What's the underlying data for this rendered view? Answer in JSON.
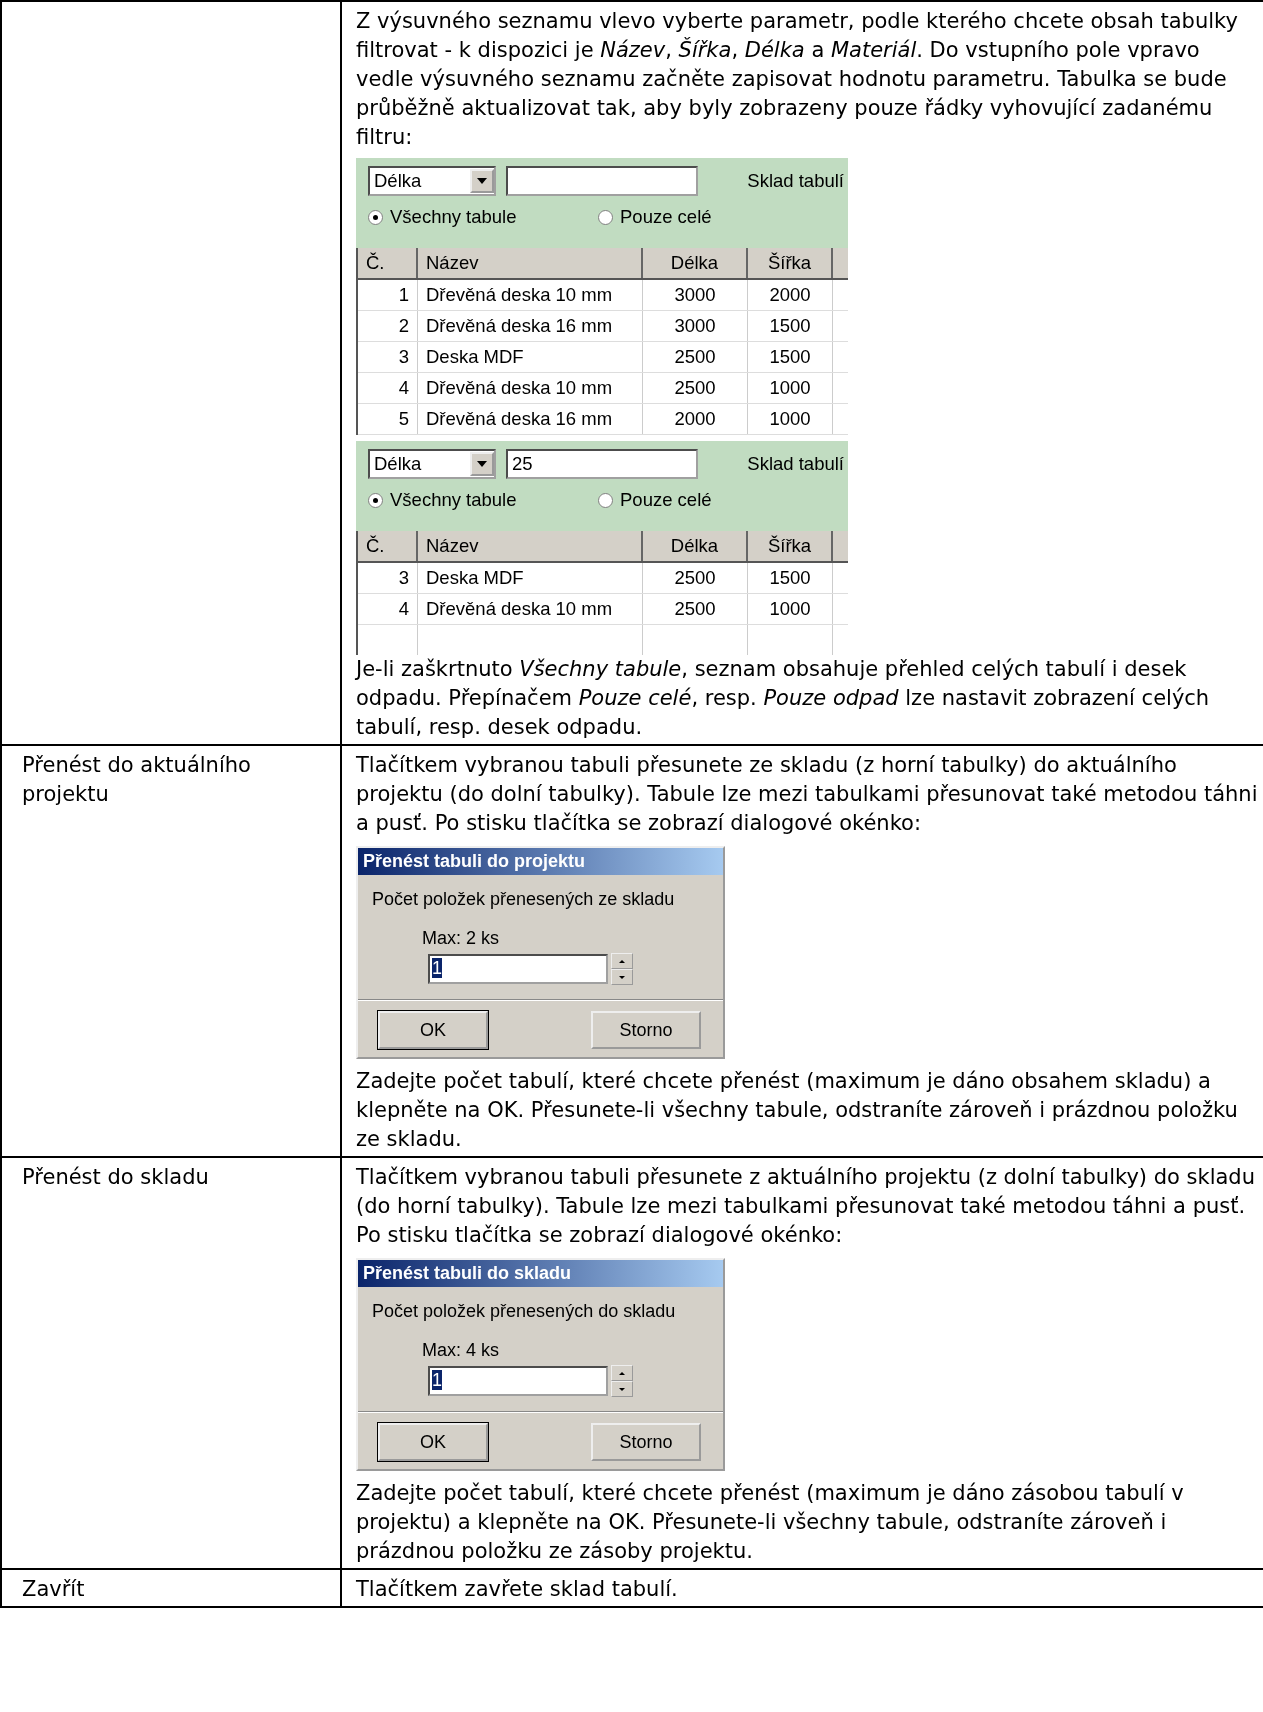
{
  "rows": [
    {
      "blocks": [
        {
          "kind": "paragraph",
          "text": "Z výsuvného seznamu vlevo vyberte parametr, podle kterého chcete obsah tabulky filtrovat - k dispozici je *Název*, *Šířka*, *Délka* a *Materiál*. Do vstupního pole vpravo vedle výsuvného seznamu začněte zapisovat hodnotu parametru. Tabulka se bude průběžně aktualizovat tak, aby byly zobrazeny pouze řádky vyhovující zadanému filtru:"
        },
        {
          "kind": "filter_panel",
          "dropdown": "Délka",
          "title": "Sklad tabulí",
          "options": [
            {
              "label": "Všechny tabule",
              "selected": true
            },
            {
              "label": "Pouze celé",
              "selected": false
            }
          ],
          "columns": [
            "Č.",
            "Název",
            "Délka",
            "Šířka"
          ],
          "rows": [
            [
              "1",
              "Dřevěná deska 10 mm",
              "3000",
              "2000"
            ],
            [
              "2",
              "Dřevěná deska 16 mm",
              "3000",
              "1500"
            ],
            [
              "3",
              "Deska MDF",
              "2500",
              "1500"
            ],
            [
              "4",
              "Dřevěná deska 10 mm",
              "2500",
              "1000"
            ],
            [
              "5",
              "Dřevěná deska 16 mm",
              "2000",
              "1000"
            ]
          ]
        },
        {
          "kind": "filter_panel",
          "dropdown": "Délka",
          "filter_value": "25",
          "title": "Sklad tabulí",
          "options": [
            {
              "label": "Všechny tabule",
              "selected": true
            },
            {
              "label": "Pouze celé",
              "selected": false
            }
          ],
          "columns": [
            "Č.",
            "Název",
            "Délka",
            "Šířka"
          ],
          "rows": [
            [
              "3",
              "Deska MDF",
              "2500",
              "1500"
            ],
            [
              "4",
              "Dřevěná deska 10 mm",
              "2500",
              "1000"
            ]
          ]
        },
        {
          "kind": "paragraph",
          "text": "Je-li zaškrtnuto *Všechny tabule*, seznam obsahuje přehled celých tabulí i desek odpadu. Přepínačem *Pouze celé*, resp. *Pouze odpad* lze nastavit zobrazení celých tabulí, resp. desek odpadu."
        }
      ]
    },
    {
      "label": "Přenést do aktuálního projektu",
      "blocks": [
        {
          "kind": "paragraph",
          "text": "Tlačítkem vybranou tabuli přesunete ze skladu (z horní tabulky) do aktuálního projektu (do dolní tabulky). Tabule lze mezi tabulkami přesunovat také metodou táhni a pusť. Po stisku tlačítka se zobrazí dialogové okénko:"
        },
        {
          "kind": "dialog",
          "title": "Přenést tabuli do projektu",
          "prompt": "Počet položek přenesených ze skladu",
          "max": "Max: 2 ks",
          "value": "1",
          "buttons": [
            "OK",
            "Storno"
          ]
        },
        {
          "kind": "paragraph",
          "text": "Zadejte počet tabulí, které chcete přenést (maximum je dáno obsahem skladu) a klepněte na OK. Přesunete-li všechny tabule, odstraníte zároveň i prázdnou položku ze skladu."
        }
      ]
    },
    {
      "label": "Přenést do skladu",
      "blocks": [
        {
          "kind": "paragraph",
          "text": "Tlačítkem vybranou tabuli přesunete z aktuálního projektu (z dolní tabulky) do skladu (do horní tabulky). Tabule lze mezi tabulkami přesunovat také metodou táhni a pusť. Po stisku tlačítka se zobrazí dialogové okénko:"
        },
        {
          "kind": "dialog",
          "title": "Přenést tabuli do skladu",
          "prompt": "Počet položek přenesených do skladu",
          "max": "Max: 4 ks",
          "value": "1",
          "buttons": [
            "OK",
            "Storno"
          ]
        },
        {
          "kind": "paragraph",
          "text": "Zadejte počet tabulí, které chcete přenést (maximum je dáno zásobou tabulí v projektu) a klepněte na OK. Přesunete-li všechny tabule, odstraníte zároveň i prázdnou položku ze zásoby projektu."
        }
      ]
    },
    {
      "label": "Zavřít",
      "blocks": [
        {
          "kind": "paragraph",
          "text": "Tlačítkem zavřete sklad tabulí."
        }
      ]
    }
  ]
}
